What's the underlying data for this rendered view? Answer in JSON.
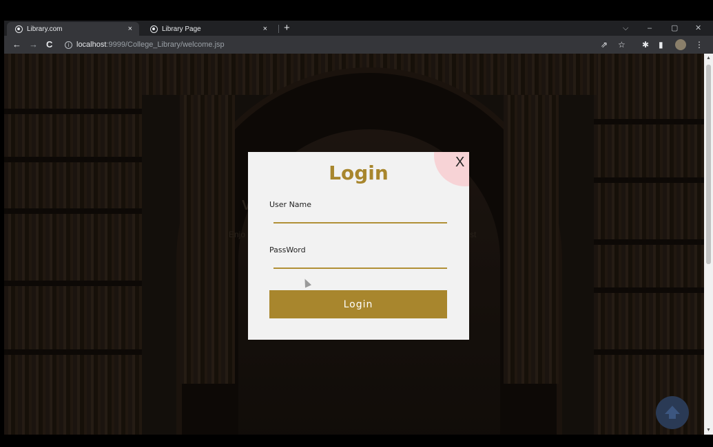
{
  "tabs": [
    {
      "title": "Library.com",
      "close": "×"
    },
    {
      "title": "Library Page",
      "close": "×"
    }
  ],
  "newtab": "+",
  "window_controls": {
    "chevron": "⌵",
    "minimize": "–",
    "restore": "▢",
    "close": "✕"
  },
  "toolbar": {
    "back": "←",
    "forward": "→",
    "reload": "C",
    "url_host": "localhost",
    "url_path": ":9999/College_Library/welcome.jsp",
    "info": "i",
    "share_icon": "⇗",
    "star_icon": "☆",
    "extensions_icon": "✱",
    "sidebar_icon": "▮",
    "menu_icon": "⋮"
  },
  "modal": {
    "title": "Login",
    "close": "X",
    "username_label": "User Name",
    "username_value": "",
    "password_label": "PassWord",
    "password_value": "",
    "button_label": "Login"
  },
  "background": {
    "partial_text_left": "Enjo",
    "partial_text_right": "st",
    "partial_heading": "V"
  },
  "scrollbar": {
    "up": "▲",
    "down": "▼"
  },
  "colors": {
    "accent": "#a8862d",
    "modal_bg": "#f2f2f2",
    "browser_dark": "#202124"
  }
}
